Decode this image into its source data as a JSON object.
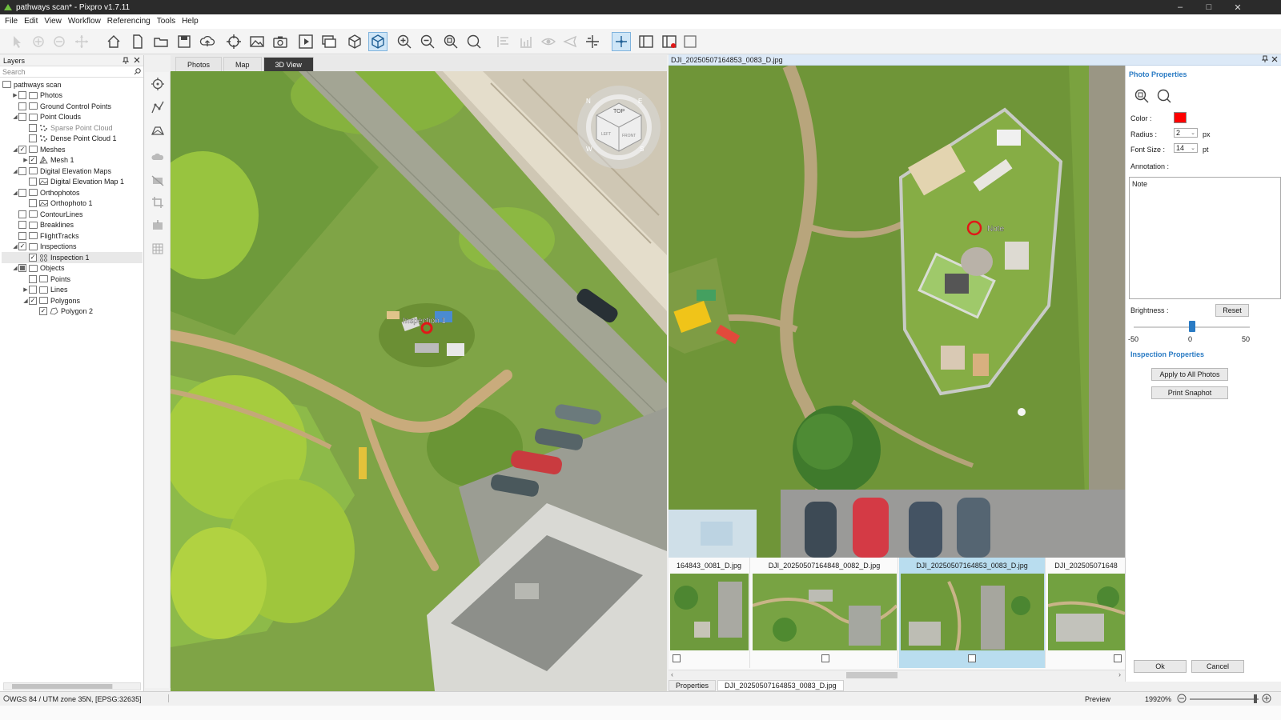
{
  "window": {
    "title": "pathways scan* - Pixpro v1.7.11",
    "controls": [
      "–",
      "□",
      "✕"
    ]
  },
  "menu": [
    "File",
    "Edit",
    "View",
    "Workflow",
    "Referencing",
    "Tools",
    "Help"
  ],
  "layers": {
    "title": "Layers",
    "search_placeholder": "Search",
    "root": "pathways scan",
    "items": [
      {
        "label": "Photos",
        "arrow": "▶",
        "checked": "",
        "icon": "folder"
      },
      {
        "label": "Ground Control Points",
        "arrow": "",
        "checked": "",
        "icon": "folder"
      },
      {
        "label": "Point Clouds",
        "arrow": "◢",
        "checked": "",
        "icon": "folder"
      },
      {
        "label": "Sparse Point Cloud",
        "arrow": "",
        "checked": "",
        "icon": "points",
        "muted": true
      },
      {
        "label": "Dense Point Cloud 1",
        "arrow": "",
        "checked": "",
        "icon": "points"
      },
      {
        "label": "Meshes",
        "arrow": "◢",
        "checked": "✓",
        "icon": "folder"
      },
      {
        "label": "Mesh 1",
        "arrow": "▶",
        "checked": "✓",
        "icon": "mesh"
      },
      {
        "label": "Digital Elevation Maps",
        "arrow": "◢",
        "checked": "",
        "icon": "folder"
      },
      {
        "label": "Digital Elevation Map 1",
        "arrow": "",
        "checked": "",
        "icon": "image"
      },
      {
        "label": "Orthophotos",
        "arrow": "◢",
        "checked": "",
        "icon": "folder"
      },
      {
        "label": "Orthophoto 1",
        "arrow": "",
        "checked": "",
        "icon": "image"
      },
      {
        "label": "ContourLines",
        "arrow": "",
        "checked": "",
        "icon": "folder"
      },
      {
        "label": "Breaklines",
        "arrow": "",
        "checked": "",
        "icon": "folder"
      },
      {
        "label": "FlightTracks",
        "arrow": "",
        "checked": "",
        "icon": "folder"
      },
      {
        "label": "Inspections",
        "arrow": "◢",
        "checked": "✓",
        "icon": "folder"
      },
      {
        "label": "Inspection 1",
        "arrow": "",
        "checked": "✓",
        "icon": "inspection"
      },
      {
        "label": "Objects",
        "arrow": "◢",
        "checked": "partial",
        "icon": "folder"
      },
      {
        "label": "Points",
        "arrow": "",
        "checked": "",
        "icon": "folder"
      },
      {
        "label": "Lines",
        "arrow": "▶",
        "checked": "",
        "icon": "folder"
      },
      {
        "label": "Polygons",
        "arrow": "◢",
        "checked": "✓",
        "icon": "folder"
      },
      {
        "label": "Polygon 2",
        "arrow": "",
        "checked": "✓",
        "icon": "polygon"
      }
    ]
  },
  "tabs": [
    "Photos",
    "Map",
    "3D View"
  ],
  "active_tab": "3D View",
  "view3d": {
    "label": "Inspection 1",
    "cube_labels": {
      "top": "TOP",
      "n": "N",
      "e": "E",
      "s": "S",
      "w": "W",
      "left": "LEFT",
      "front": "FRONT"
    }
  },
  "photo": {
    "title": "DJI_20250507164853_0083_D.jpg",
    "annotation_label": "Note"
  },
  "thumbnails": [
    {
      "name": "164843_0081_D.jpg",
      "selected": false
    },
    {
      "name": "DJI_20250507164848_0082_D.jpg",
      "selected": false
    },
    {
      "name": "DJI_20250507164853_0083_D.jpg",
      "selected": true
    },
    {
      "name": "DJI_202505071648",
      "selected": false
    }
  ],
  "bottom_tabs": [
    "Properties",
    "DJI_20250507164853_0083_D.jpg"
  ],
  "properties": {
    "photo_title": "Photo Properties",
    "color_label": "Color :",
    "color_value": "#ff0000",
    "radius_label": "Radius :",
    "radius_value": "2",
    "radius_unit": "px",
    "font_label": "Font Size :",
    "font_value": "14",
    "font_unit": "pt",
    "annotation_label": "Annotation :",
    "annotation_value": "Note",
    "brightness_label": "Brightness :",
    "reset_label": "Reset",
    "brightness_min": "-50",
    "brightness_mid": "0",
    "brightness_max": "50",
    "brightness_value": 0,
    "inspection_title": "Inspection Properties",
    "apply_label": "Apply to All Photos",
    "print_label": "Print Snaphot",
    "ok_label": "Ok",
    "cancel_label": "Cancel"
  },
  "status": {
    "crs": "WGS 84 / UTM zone 35N, [EPSG:32635]",
    "mode": "Preview",
    "zoom": "19920%"
  },
  "colors": {
    "accent_blue": "#2a7bc4",
    "selected_thumb": "#b9ddef",
    "marker_red": "#e01818",
    "titlebar": "#2b2b2b"
  }
}
